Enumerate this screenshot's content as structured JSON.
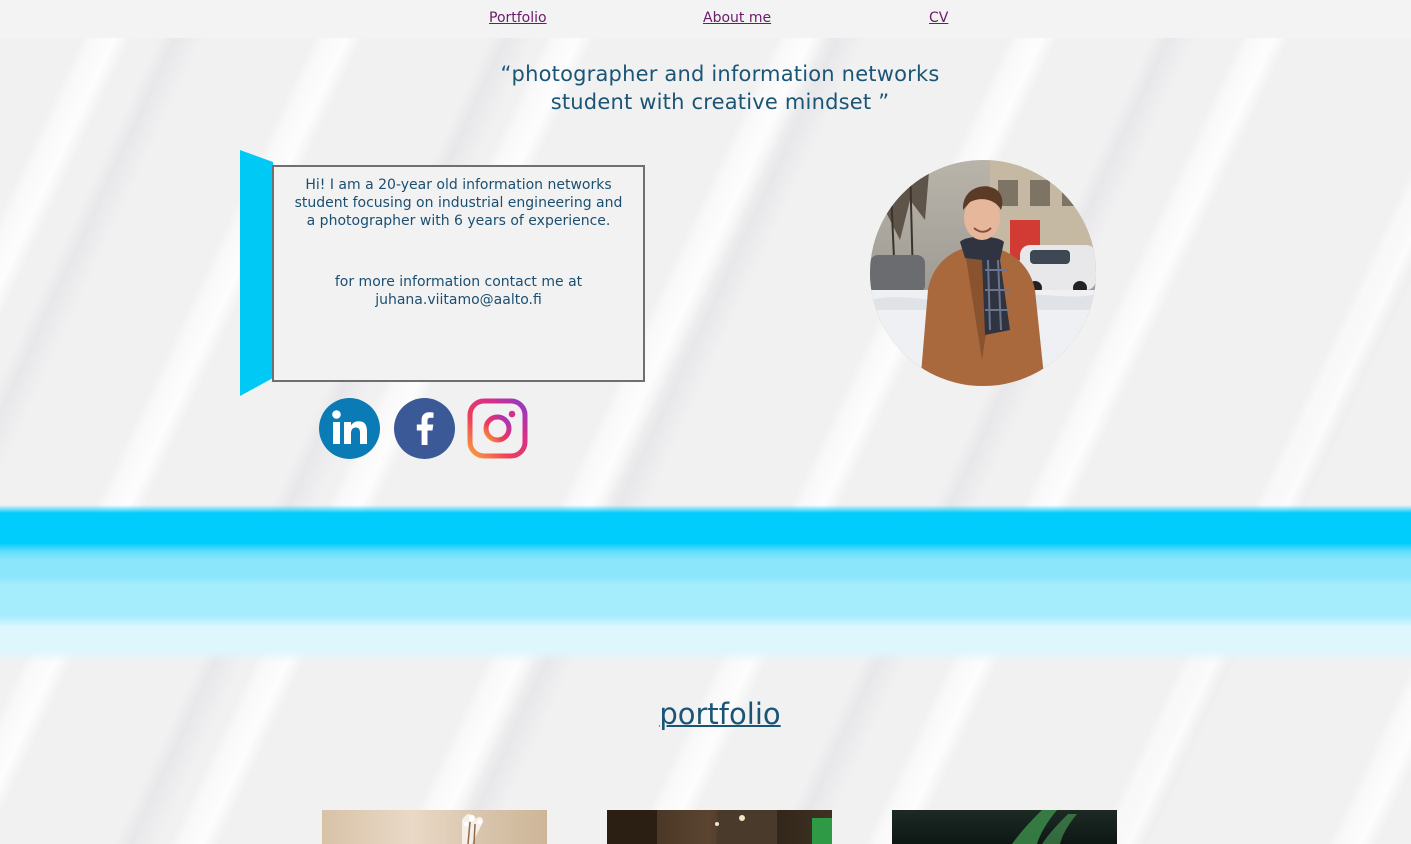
{
  "nav": {
    "items": [
      {
        "label": "Portfolio"
      },
      {
        "label": "About me"
      },
      {
        "label": "CV"
      }
    ]
  },
  "tagline": {
    "line1": "“photographer and information networks",
    "line2": "student with creative mindset ”"
  },
  "intro": {
    "line1": "Hi! I am a 20-year old information networks",
    "line2": "student focusing on industrial engineering and",
    "line3": "a photographer with 6 years of experience.",
    "contact_line": "for more information contact me at",
    "email": "juhana.viitamo@aalto.fi"
  },
  "social": {
    "linkedin_icon": "linkedin-icon",
    "facebook_icon": "facebook-icon",
    "instagram_icon": "instagram-icon"
  },
  "portfolio": {
    "heading": "portfolio"
  },
  "colors": {
    "accent_cyan": "#00c9f5",
    "text_blue": "#1b5576",
    "nav_link": "#6a1b6a",
    "linkedin": "#0a7bb5",
    "facebook": "#3b5897"
  }
}
